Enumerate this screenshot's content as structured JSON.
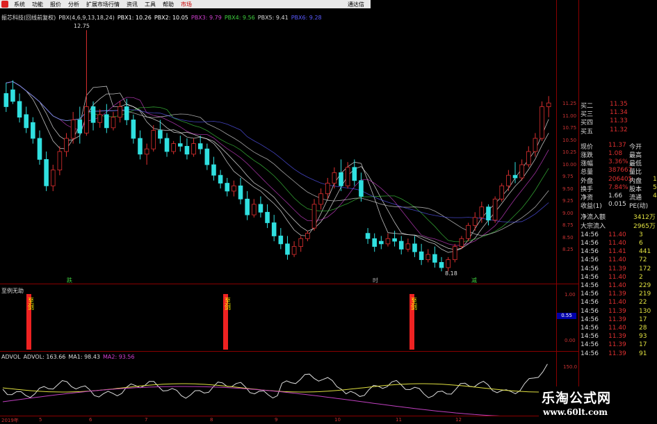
{
  "menu": {
    "items": [
      "系统",
      "功能",
      "报价",
      "分析",
      "扩展市场行情",
      "资讯",
      "工具",
      "帮助",
      "市场"
    ],
    "right_label": "通达信"
  },
  "main_panel": {
    "title": "振芯科技(回线前复权)",
    "params": "PBX(4,6,9,13,18,24)",
    "pbx": [
      {
        "label": "PBX1: 10.26",
        "color": "#ffffff"
      },
      {
        "label": "PBX2: 10.05",
        "color": "#ffffff"
      },
      {
        "label": "PBX3: 9.79",
        "color": "#d040d0"
      },
      {
        "label": "PBX4: 9.56",
        "color": "#40d040"
      },
      {
        "label": "PBX5: 9.41",
        "color": "#dddddd"
      },
      {
        "label": "PBX6: 9.28",
        "color": "#5a5aff"
      }
    ],
    "high_label": "12.75",
    "low_label": "8.18",
    "markers": [
      {
        "text": "跌",
        "color": "#40d040"
      },
      {
        "text": "时",
        "color": "#aaaaaa"
      },
      {
        "text": "减",
        "color": "#40d040"
      }
    ],
    "y_ticks": [
      "11.25",
      "11.00",
      "10.75",
      "10.50",
      "10.25",
      "10.00",
      "9.75",
      "9.50",
      "9.25",
      "9.00",
      "8.75",
      "8.50",
      "8.25"
    ]
  },
  "signal_panel": {
    "title": "至例无助",
    "sig_text": "至剑",
    "y_ticks": [
      "1.00",
      "0.55",
      "0.00"
    ],
    "current": "0.55"
  },
  "vol_panel": {
    "title": "ADVOL",
    "advol": "ADVOL: 163.66",
    "ma1": "MA1: 98.43",
    "ma2": "MA2: 93.56",
    "y_tick": "150.0"
  },
  "dates": [
    "2019年",
    "5",
    "6",
    "7",
    "8",
    "9",
    "10",
    "11",
    "12"
  ],
  "quote": {
    "asks": [
      {
        "label": "买二",
        "price": "11.35"
      },
      {
        "label": "买三",
        "price": "11.34"
      },
      {
        "label": "买四",
        "price": "11.33"
      },
      {
        "label": "买五",
        "price": "11.32"
      }
    ],
    "stats": [
      {
        "l1": "现价",
        "v1": "11.37",
        "l2": "今开",
        "v2": ""
      },
      {
        "l1": "涨跌",
        "v1": "1.08",
        "l2": "最高",
        "v2": ""
      },
      {
        "l1": "涨幅",
        "v1": "3.36%",
        "l2": "最低",
        "v2": ""
      },
      {
        "l1": "总量",
        "v1": "387667",
        "l2": "量比",
        "v2": ""
      },
      {
        "l1": "外盘",
        "v1": "206405",
        "l2": "内盘",
        "v2": "18"
      },
      {
        "l1": "换手",
        "v1": "7.84%",
        "l2": "股本",
        "v2": "5"
      },
      {
        "l1": "净资",
        "v1": "1.66",
        "l2": "流通",
        "v2": "4"
      },
      {
        "l1": "收益(1)",
        "v1": "0.015",
        "l2": "PE(动)",
        "v2": ""
      }
    ],
    "flows": [
      {
        "label": "净流入额",
        "value": "3412万"
      },
      {
        "label": "大宗流入",
        "value": "2965万"
      }
    ],
    "ticks": [
      {
        "t": "14:56",
        "p": "11.40",
        "v": "3"
      },
      {
        "t": "14:56",
        "p": "11.40",
        "v": "6"
      },
      {
        "t": "14:56",
        "p": "11.41",
        "v": "441"
      },
      {
        "t": "14:56",
        "p": "11.40",
        "v": "72"
      },
      {
        "t": "14:56",
        "p": "11.39",
        "v": "172"
      },
      {
        "t": "14:56",
        "p": "11.40",
        "v": "2"
      },
      {
        "t": "14:56",
        "p": "11.40",
        "v": "229"
      },
      {
        "t": "14:56",
        "p": "11.39",
        "v": "219"
      },
      {
        "t": "14:56",
        "p": "11.40",
        "v": "22"
      },
      {
        "t": "14:56",
        "p": "11.39",
        "v": "130"
      },
      {
        "t": "14:56",
        "p": "11.39",
        "v": "17"
      },
      {
        "t": "14:56",
        "p": "11.40",
        "v": "28"
      },
      {
        "t": "14:56",
        "p": "11.39",
        "v": "93"
      },
      {
        "t": "14:56",
        "p": "11.39",
        "v": "17"
      },
      {
        "t": "14:56",
        "p": "11.39",
        "v": "91"
      }
    ]
  },
  "watermark": {
    "cn": "乐淘公式网",
    "url": "www.60lt.com"
  },
  "colors": {
    "up": "#e03030",
    "down": "#30e0e0",
    "axis": "#8b0000",
    "signal": "#e22222"
  },
  "chart_data": {
    "type": "candlestick",
    "ylim": [
      8.0,
      12.9
    ],
    "candles": [
      [
        11.55,
        11.75,
        11.3,
        11.2
      ],
      [
        11.62,
        11.8,
        11.4,
        11.35
      ],
      [
        11.4,
        11.55,
        11.1,
        11.0
      ],
      [
        11.15,
        11.3,
        10.9,
        10.8
      ],
      [
        11.0,
        11.1,
        10.7,
        10.6
      ],
      [
        10.7,
        10.85,
        10.3,
        10.2
      ],
      [
        10.3,
        10.45,
        9.8,
        9.7
      ],
      [
        9.8,
        10.2,
        10.1,
        9.7
      ],
      [
        10.1,
        10.55,
        10.45,
        10.0
      ],
      [
        10.45,
        10.8,
        10.7,
        10.35
      ],
      [
        10.7,
        11.2,
        11.05,
        10.6
      ],
      [
        11.05,
        11.3,
        10.8,
        10.6
      ],
      [
        10.8,
        12.75,
        11.3,
        10.75
      ],
      [
        11.3,
        11.4,
        11.0,
        10.85
      ],
      [
        11.0,
        11.25,
        11.15,
        10.9
      ],
      [
        11.15,
        11.35,
        10.9,
        10.8
      ],
      [
        10.9,
        11.2,
        11.1,
        10.85
      ],
      [
        11.1,
        11.4,
        11.3,
        11.0
      ],
      [
        11.3,
        11.45,
        11.05,
        10.95
      ],
      [
        11.05,
        11.15,
        10.7,
        10.6
      ],
      [
        10.7,
        10.85,
        10.4,
        10.3
      ],
      [
        10.4,
        10.6,
        10.5,
        10.2
      ],
      [
        10.5,
        10.95,
        10.85,
        10.45
      ],
      [
        10.85,
        11.05,
        10.7,
        10.6
      ],
      [
        10.7,
        10.8,
        10.45,
        10.35
      ],
      [
        10.45,
        10.65,
        10.6,
        10.4
      ],
      [
        10.6,
        10.75,
        10.55,
        10.45
      ],
      [
        10.55,
        10.7,
        10.4,
        10.3
      ],
      [
        10.4,
        10.7,
        10.6,
        10.35
      ],
      [
        10.6,
        10.75,
        10.5,
        10.4
      ],
      [
        10.5,
        10.6,
        10.2,
        10.1
      ],
      [
        10.2,
        10.35,
        10.0,
        9.9
      ],
      [
        10.0,
        10.1,
        9.85,
        9.75
      ],
      [
        9.85,
        9.95,
        9.7,
        9.6
      ],
      [
        9.7,
        9.9,
        9.8,
        9.6
      ],
      [
        9.8,
        9.95,
        9.55,
        9.45
      ],
      [
        9.55,
        9.7,
        9.25,
        9.15
      ],
      [
        9.25,
        9.55,
        9.45,
        9.2
      ],
      [
        9.45,
        9.6,
        9.3,
        9.2
      ],
      [
        9.3,
        9.45,
        9.1,
        9.0
      ],
      [
        9.1,
        9.25,
        8.85,
        8.75
      ],
      [
        8.85,
        9.0,
        8.7,
        8.6
      ],
      [
        8.7,
        8.85,
        8.5,
        8.4
      ],
      [
        8.5,
        8.75,
        8.65,
        8.45
      ],
      [
        8.65,
        8.85,
        8.8,
        8.55
      ],
      [
        8.8,
        8.95,
        8.9,
        8.75
      ],
      [
        9.0,
        9.55,
        9.45,
        8.95
      ],
      [
        9.45,
        9.75,
        9.65,
        9.35
      ],
      [
        9.65,
        9.95,
        9.85,
        9.55
      ],
      [
        9.85,
        10.15,
        10.05,
        9.75
      ],
      [
        10.05,
        10.3,
        9.8,
        9.7
      ],
      [
        9.8,
        10.25,
        10.15,
        9.75
      ],
      [
        10.15,
        10.3,
        9.9,
        9.8
      ],
      [
        9.9,
        10.05,
        9.6,
        9.5
      ],
      [
        8.9,
        9.0,
        8.8,
        8.7
      ],
      [
        8.8,
        8.9,
        8.65,
        8.55
      ],
      [
        8.75,
        8.85,
        8.7,
        8.6
      ],
      [
        8.7,
        8.9,
        8.8,
        8.65
      ],
      [
        8.8,
        8.95,
        8.75,
        8.65
      ],
      [
        8.75,
        8.85,
        8.6,
        8.5
      ],
      [
        8.6,
        8.8,
        8.7,
        8.55
      ],
      [
        8.7,
        8.85,
        8.55,
        8.45
      ],
      [
        8.55,
        8.7,
        8.4,
        8.3
      ],
      [
        8.4,
        8.6,
        8.5,
        8.35
      ],
      [
        8.5,
        8.65,
        8.35,
        8.25
      ],
      [
        8.35,
        8.45,
        8.25,
        8.18
      ],
      [
        8.25,
        8.45,
        8.4,
        8.18
      ],
      [
        8.4,
        8.7,
        8.65,
        8.35
      ],
      [
        8.65,
        8.85,
        8.8,
        8.6
      ],
      [
        8.8,
        9.1,
        9.05,
        8.75
      ],
      [
        9.05,
        9.3,
        9.2,
        8.95
      ],
      [
        9.2,
        9.5,
        9.4,
        9.1
      ],
      [
        9.4,
        9.45,
        9.15,
        9.05
      ],
      [
        9.15,
        9.6,
        9.55,
        9.1
      ],
      [
        9.55,
        9.85,
        9.8,
        9.5
      ],
      [
        9.8,
        10.1,
        10.0,
        9.7
      ],
      [
        10.0,
        10.25,
        9.95,
        9.85
      ],
      [
        9.95,
        10.3,
        10.2,
        9.9
      ],
      [
        10.2,
        10.55,
        10.45,
        10.15
      ],
      [
        10.45,
        10.8,
        10.7,
        10.35
      ],
      [
        10.7,
        11.4,
        11.3,
        10.65
      ],
      [
        11.3,
        11.5,
        11.37,
        11.1
      ]
    ]
  }
}
